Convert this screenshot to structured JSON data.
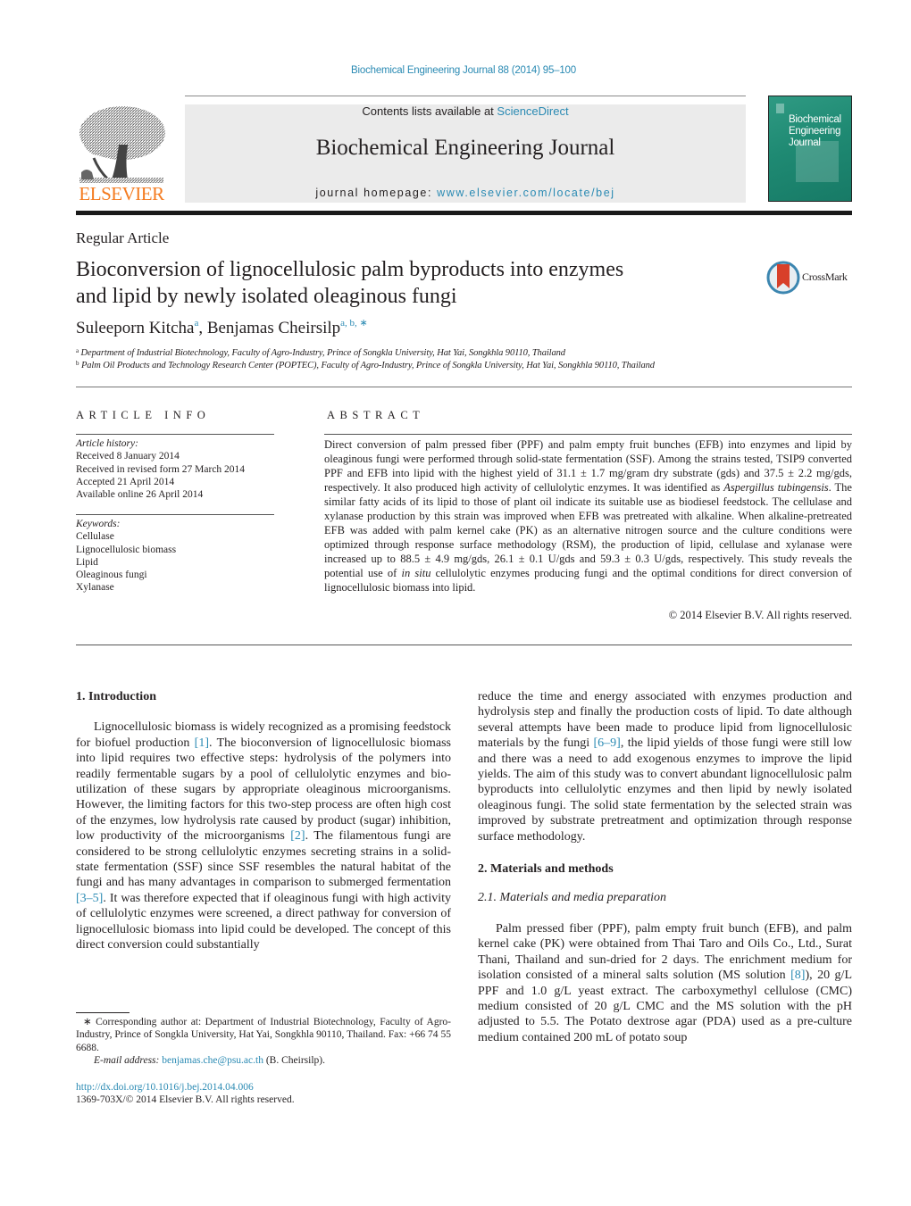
{
  "header": {
    "citation": "Biochemical Engineering Journal 88 (2014) 95–100",
    "contents_prefix": "Contents lists available at ",
    "contents_link": "ScienceDirect",
    "journal_name": "Biochemical Engineering Journal",
    "homepage_prefix": "journal homepage: ",
    "homepage_link": "www.elsevier.com/locate/bej",
    "publisher_logo": "ELSEVIER",
    "cover_title_lines": [
      "Biochemical",
      "Engineering",
      "Journal"
    ],
    "colors": {
      "link": "#2a8ab3",
      "elsevier_orange": "#f47b20",
      "cover_teal": "#1f8a73"
    }
  },
  "article": {
    "type": "Regular Article",
    "title_line1": "Bioconversion of lignocellulosic palm byproducts into enzymes",
    "title_line2": "and lipid by newly isolated oleaginous fungi",
    "crossmark_label": "CrossMark",
    "authors": [
      {
        "name": "Suleeporn Kitcha",
        "sup": "a"
      },
      {
        "name": "Benjamas Cheirsilp",
        "sup": "a, b, ∗"
      }
    ],
    "affiliations": [
      {
        "mark": "a",
        "text": "Department of Industrial Biotechnology, Faculty of Agro-Industry, Prince of Songkla University, Hat Yai, Songkhla 90110, Thailand"
      },
      {
        "mark": "b",
        "text": "Palm Oil Products and Technology Research Center (POPTEC), Faculty of Agro-Industry, Prince of Songkla University, Hat Yai, Songkhla 90110, Thailand"
      }
    ]
  },
  "article_info": {
    "heading": "ARTICLE INFO",
    "history_label": "Article history:",
    "history": [
      "Received 8 January 2014",
      "Received in revised form 27 March 2014",
      "Accepted 21 April 2014",
      "Available online 26 April 2014"
    ],
    "keywords_label": "Keywords:",
    "keywords": [
      "Cellulase",
      "Lignocellulosic biomass",
      "Lipid",
      "Oleaginous fungi",
      "Xylanase"
    ]
  },
  "abstract": {
    "heading": "ABSTRACT",
    "part1": "Direct conversion of palm pressed fiber (PPF) and palm empty fruit bunches (EFB) into enzymes and lipid by oleaginous fungi were performed through solid-state fermentation (SSF). Among the strains tested, TSIP9 converted PPF and EFB into lipid with the highest yield of 31.1 ± 1.7 mg/gram dry substrate (gds) and 37.5 ± 2.2 mg/gds, respectively. It also produced high activity of cellulolytic enzymes. It was identified as ",
    "species": "Aspergillus tubingensis",
    "part2": ". The similar fatty acids of its lipid to those of plant oil indicate its suitable use as biodiesel feedstock. The cellulase and xylanase production by this strain was improved when EFB was pretreated with alkaline. When alkaline-pretreated EFB was added with palm kernel cake (PK) as an alternative nitrogen source and the culture conditions were optimized through response surface methodology (RSM), the production of lipid, cellulase and xylanase were increased up to 88.5 ± 4.9 mg/gds, 26.1 ± 0.1 U/gds and 59.3 ± 0.3 U/gds, respectively. This study reveals the potential use of ",
    "in_situ": "in situ",
    "part3": " cellulolytic enzymes producing fungi and the optimal conditions for direct conversion of lignocellulosic biomass into lipid.",
    "copyright": "© 2014 Elsevier B.V. All rights reserved."
  },
  "body": {
    "intro_heading": "1.  Introduction",
    "intro_p1_a": "Lignocellulosic biomass is widely recognized as a promising feedstock for biofuel production ",
    "ref1": "[1]",
    "intro_p1_b": ". The bioconversion of lignocellulosic biomass into lipid requires two effective steps: hydrolysis of the polymers into readily fermentable sugars by a pool of cellulolytic enzymes and bio-utilization of these sugars by appropriate oleaginous microorganisms. However, the limiting factors for this two-step process are often high cost of the enzymes, low hydrolysis rate caused by product (sugar) inhibition, low productivity of the microorganisms ",
    "ref2": "[2]",
    "intro_p1_c": ". The filamentous fungi are considered to be strong cellulolytic enzymes secreting strains in a solid-state fermentation (SSF) since SSF resembles the natural habitat of the fungi and has many advantages in comparison to submerged fermentation ",
    "ref3": "[3–5]",
    "intro_p1_d": ". It was therefore expected that if oleaginous fungi with high activity of cellulolytic enzymes were screened, a direct pathway for conversion of lignocellulosic biomass into lipid could be developed. The concept of this direct conversion could substantially",
    "right_p1_a": "reduce the time and energy associated with enzymes production and hydrolysis step and finally the production costs of lipid. To date although several attempts have been made to produce lipid from lignocellulosic materials by the fungi ",
    "ref4": "[6–9]",
    "right_p1_b": ", the lipid yields of those fungi were still low and there was a need to add exogenous enzymes to improve the lipid yields. The aim of this study was to convert abundant lignocellulosic palm byproducts into cellulolytic enzymes and then lipid by newly isolated oleaginous fungi. The solid state fermentation by the selected strain was improved by substrate pretreatment and optimization through response surface methodology.",
    "methods_heading": "2.  Materials and methods",
    "methods_sub": "2.1.  Materials and media preparation",
    "methods_p1_a": "Palm pressed fiber (PPF), palm empty fruit bunch (EFB), and palm kernel cake (PK) were obtained from Thai Taro and Oils Co., Ltd., Surat Thani, Thailand and sun-dried for 2 days. The enrichment medium for isolation consisted of a mineral salts solution (MS solution ",
    "ref5": "[8]",
    "methods_p1_b": "), 20 g/L PPF and 1.0 g/L yeast extract. The carboxymethyl cellulose (CMC) medium consisted of 20 g/L CMC and the MS solution with the pH adjusted to 5.5. The Potato dextrose agar (PDA) used as a pre-culture medium contained 200 mL of potato soup"
  },
  "footnote": {
    "line": "∗  Corresponding author at: Department of Industrial Biotechnology, Faculty of Agro-Industry, Prince of Songkla University, Hat Yai, Songkhla 90110, Thailand. Fax: +66 74 55 6688.",
    "email_label": "E-mail address: ",
    "email": "benjamas.che@psu.ac.th",
    "email_suffix": " (B. Cheirsilp).",
    "doi": "http://dx.doi.org/10.1016/j.bej.2014.04.006",
    "issn": "1369-703X/© 2014 Elsevier B.V. All rights reserved."
  }
}
